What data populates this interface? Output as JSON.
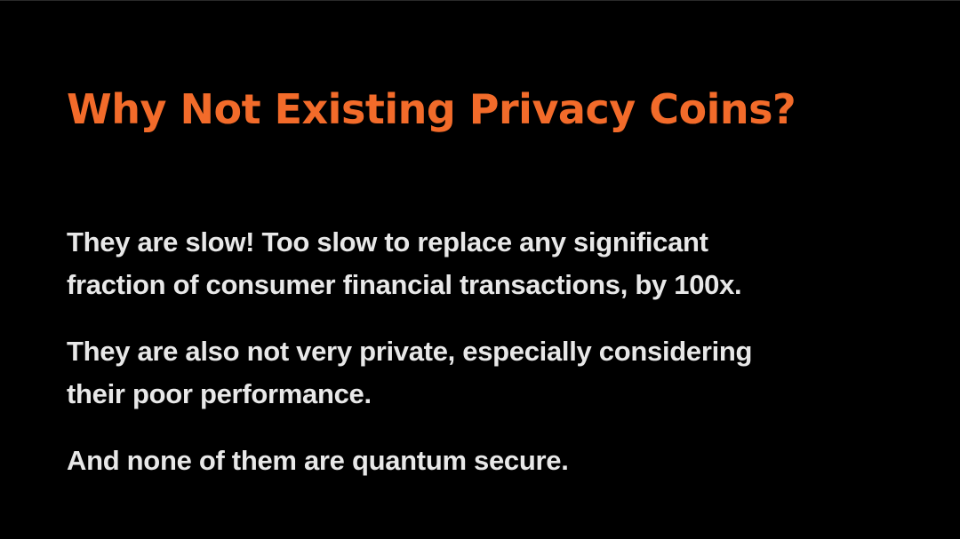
{
  "slide": {
    "title": "Why Not Existing Privacy Coins?",
    "paragraphs": [
      [
        "They are slow!  Too slow to replace any significant",
        "fraction of consumer financial transactions, by 100x."
      ],
      [
        "They are also not very private, especially considering",
        "their poor performance."
      ],
      [
        "And none of them are quantum secure."
      ]
    ]
  },
  "colors": {
    "background": "#000000",
    "title": "#f26b2a",
    "body_text": "#e8e8e8"
  }
}
